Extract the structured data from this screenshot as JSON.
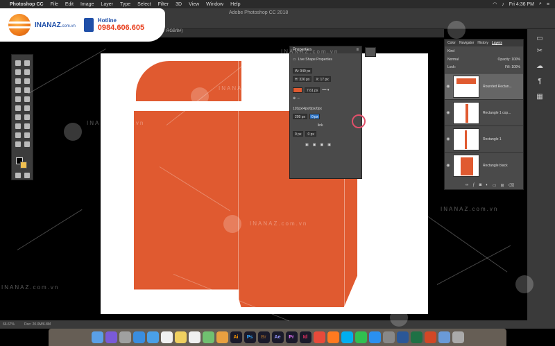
{
  "menubar": {
    "app": "Photoshop CC",
    "items": [
      "File",
      "Edit",
      "Image",
      "Layer",
      "Type",
      "Select",
      "Filter",
      "3D",
      "View",
      "Window",
      "Help"
    ],
    "clock": "Fri 4:36 PM"
  },
  "window": {
    "title": "Adobe Photoshop CC 2018",
    "doc_tab": "RGB/8#)"
  },
  "brand": {
    "logo": "INANAZ",
    "domain": ".com.vn",
    "hotline_label": "Hotline",
    "hotline_number": "0984.606.605"
  },
  "watermark": "INANAZ.com.vn",
  "properties": {
    "title": "Properties",
    "heading": "Live Shape Properties",
    "w": "W: 949 px",
    "h": "H: 326 px",
    "x": "X: 17 px",
    "stroke_size": "7.61 px",
    "radius_label": "120px/4px/0px/0px",
    "radius_tl": "209 px",
    "radius_tr": "0 px",
    "radius_bl": "0 px",
    "radius_br": "0 px",
    "link": "link",
    "shape_color": "#e05a30"
  },
  "layers": {
    "tabs": [
      "Color",
      "Navigator",
      "History",
      "Layers"
    ],
    "active_tab": "Layers",
    "kind": "Kind",
    "mode": "Normal",
    "opacity": "Opacity: 100%",
    "fill": "Fill: 100%",
    "lock": "Lock:",
    "items": [
      {
        "name": "Rounded Rectan...",
        "active": true
      },
      {
        "name": "Rectangle 1 cop...",
        "active": false
      },
      {
        "name": "Rectangle 1",
        "active": false
      },
      {
        "name": "Rectangle black",
        "active": false
      }
    ]
  },
  "status": {
    "zoom": "66.67%",
    "doc_size": "Doc: 20.0M/6.8M"
  },
  "dock_apps": [
    "Finder",
    "Siri",
    "Launchpad",
    "Safari",
    "Mail",
    "Calendar",
    "Notes",
    "Reminders",
    "Maps",
    "Photos",
    "Ai",
    "Ps",
    "Br",
    "Ae",
    "Pr",
    "Id",
    "Chrome",
    "Firefox",
    "Skype",
    "Messages",
    "App Store",
    "Settings",
    "Word",
    "Excel",
    "PowerPoint",
    "Preview",
    "Trash"
  ],
  "colors": {
    "accent": "#e05a30",
    "brand": "#1f4fa8",
    "hotline": "#e8401f"
  }
}
